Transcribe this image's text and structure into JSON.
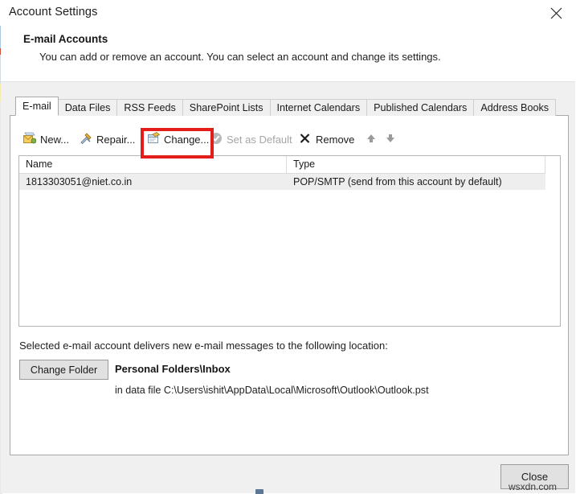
{
  "window": {
    "title": "Account Settings",
    "close_icon": "close-x-icon"
  },
  "header": {
    "title": "E-mail Accounts",
    "description": "You can add or remove an account. You can select an account and change its settings."
  },
  "tabs": [
    {
      "label": "E-mail",
      "active": true
    },
    {
      "label": "Data Files",
      "active": false
    },
    {
      "label": "RSS Feeds",
      "active": false
    },
    {
      "label": "SharePoint Lists",
      "active": false
    },
    {
      "label": "Internet Calendars",
      "active": false
    },
    {
      "label": "Published Calendars",
      "active": false
    },
    {
      "label": "Address Books",
      "active": false
    }
  ],
  "toolbar": {
    "new_label": "New...",
    "repair_label": "Repair...",
    "change_label": "Change...",
    "set_default_label": "Set as Default",
    "remove_label": "Remove",
    "move_up_icon": "arrow-up-icon",
    "move_down_icon": "arrow-down-icon",
    "new_icon": "new-mail-icon",
    "repair_icon": "hammer-wrench-icon",
    "change_icon": "change-window-icon",
    "set_default_icon": "check-circle-icon",
    "remove_icon": "x-remove-icon",
    "highlight_color": "#e31d19",
    "highlighted_button": "Change..."
  },
  "accounts_list": {
    "columns": [
      "Name",
      "Type"
    ],
    "rows": [
      {
        "name": "1813303051@niet.co.in",
        "type": "POP/SMTP (send from this account by default)",
        "selected": true
      }
    ]
  },
  "delivery": {
    "label": "Selected e-mail account delivers new e-mail messages to the following location:",
    "change_folder_label": "Change Folder",
    "folder": "Personal Folders\\Inbox",
    "data_file": "in data file C:\\Users\\ishit\\AppData\\Local\\Microsoft\\Outlook\\Outlook.pst"
  },
  "footer": {
    "close_label": "Close"
  },
  "watermark": {
    "text": "wsxdn.com"
  }
}
